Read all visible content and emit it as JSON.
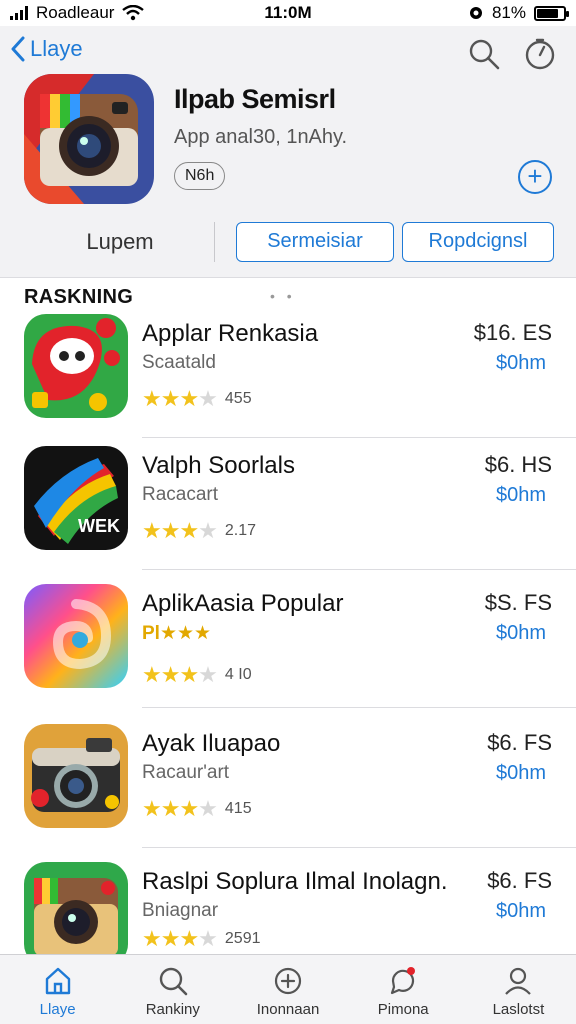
{
  "status_bar": {
    "carrier": "Roadleaur",
    "time": "11:0M",
    "battery": "81%",
    "battery_level": 0.81
  },
  "nav": {
    "back_label": "Llaye"
  },
  "hero": {
    "title": "Ilpab Semisrl",
    "subtitle": "App anal30, 1nAhy.",
    "tag": "N6h"
  },
  "segment": {
    "plain": "Lupem",
    "left_button": "Sermeisiar",
    "right_button": "Ropdcignsl"
  },
  "section": {
    "title": "RASKNING",
    "dots": "• •"
  },
  "apps": [
    {
      "name": "Applar Renkasia",
      "category": "Scaatald",
      "stars": "★★★",
      "half": "★",
      "rating": "455",
      "price": "$16. ES",
      "action": "$0hm"
    },
    {
      "name": "Valph Soorlals",
      "category": "Racacart",
      "stars": "★★★",
      "half": "★",
      "rating": "2.17",
      "price": "$6. HS",
      "action": "$0hm"
    },
    {
      "name": "AplikAasia Popular",
      "category": "Pl★★★",
      "stars": "★★★",
      "half": "★",
      "rating": "4 I0",
      "price": "$S. FS",
      "action": "$0hm"
    },
    {
      "name": "Ayak Iluapao",
      "category": "Racaur'art",
      "stars": "★★★",
      "half": "★",
      "rating": "415",
      "price": "$6. FS",
      "action": "$0hm"
    },
    {
      "name": "Raslpi Soplura Ilmal Inolagn.",
      "category": "Bniagnar",
      "stars": "★★★",
      "half": "★",
      "rating": "2591",
      "price": "$6. FS",
      "action": "$0hm"
    }
  ],
  "tabs": [
    {
      "label": "Llaye",
      "icon": "home-icon"
    },
    {
      "label": "Rankiny",
      "icon": "search-icon"
    },
    {
      "label": "Inonnaan",
      "icon": "plus-circle-icon"
    },
    {
      "label": "Pimona",
      "icon": "chat-icon"
    },
    {
      "label": "Laslotst",
      "icon": "person-icon"
    }
  ],
  "colors": {
    "accent": "#1f7ad6",
    "star": "#f2c21c",
    "header_bg": "#f2f2f4"
  }
}
